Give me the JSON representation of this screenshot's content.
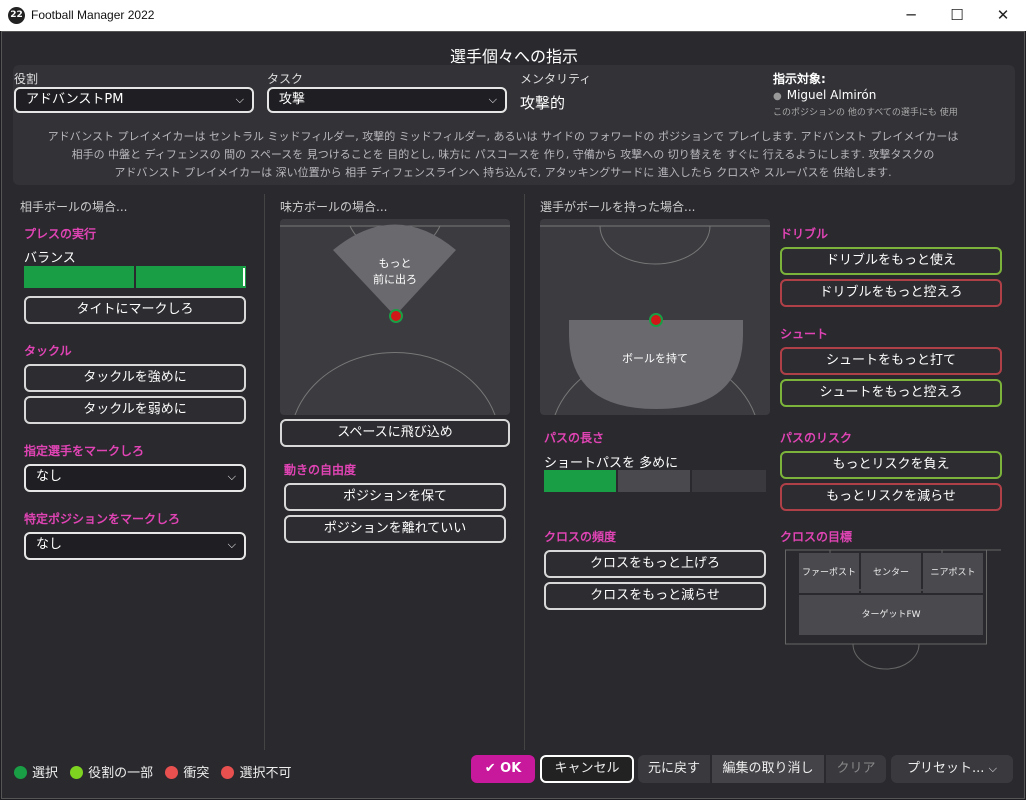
{
  "window": {
    "title": "Football Manager 2022",
    "logo": "22",
    "min": "─",
    "max": "☐",
    "close": "✕"
  },
  "dialog_title": "選手個々への指示",
  "role": {
    "label": "役割",
    "value": "アドバンストPM"
  },
  "task": {
    "label": "タスク",
    "value": "攻撃"
  },
  "mentality": {
    "label": "メンタリティ",
    "value": "攻撃的"
  },
  "target": {
    "label": "指示対象:",
    "player": "Miguel Almirón",
    "note": "このポジションの 他のすべての選手にも 使用"
  },
  "description": [
    "アドバンスト プレイメイカーは セントラル ミッドフィルダー, 攻撃的 ミッドフィルダー, あるいは サイドの フォワードの ポジションで プレイします. アドバンスト プレイメイカーは",
    "相手の 中盤と ディフェンスの 間の スペースを 見つけることを 目的とし, 味方に パスコースを 作り, 守備から 攻撃への 切り替えを すぐに 行えるようにします. 攻撃タスクの",
    "アドバンスト プレイメイカーは 深い位置から 相手 ディフェンスラインへ 持ち込んで, アタッキングサードに 進入したら クロスや スルーパスを 供給します."
  ],
  "opp_ball": {
    "header": "相手ボールの場合...",
    "press": {
      "label": "プレスの実行",
      "level_label": "バランス",
      "level": 0.5
    },
    "tight_mark": "タイトにマークしろ",
    "tackle": {
      "label": "タックル",
      "harder": "タックルを強めに",
      "softer": "タックルを弱めに"
    },
    "mark_player": {
      "label": "指定選手をマークしろ",
      "value": "なし"
    },
    "mark_position": {
      "label": "特定ポジションをマークしろ",
      "value": "なし"
    }
  },
  "team_ball": {
    "header": "味方ボールの場合...",
    "zone_label_1": "もっと",
    "zone_label_2": "前に出ろ",
    "run_space": "スペースに飛び込め",
    "freedom": {
      "label": "動きの自由度",
      "hold": "ポジションを保て",
      "roam": "ポジションを離れていい"
    }
  },
  "on_ball": {
    "header": "選手がボールを持った場合...",
    "zone_label": "ボールを持て",
    "pass_length": {
      "label": "パスの長さ",
      "value": "ショートパスを 多めに",
      "level": 1
    },
    "cross_freq": {
      "label": "クロスの頻度",
      "more": "クロスをもっと上げろ",
      "less": "クロスをもっと減らせ"
    },
    "dribble": {
      "label": "ドリブル",
      "more": "ドリブルをもっと使え",
      "less": "ドリブルをもっと控えろ"
    },
    "shoot": {
      "label": "シュート",
      "more": "シュートをもっと打て",
      "less": "シュートをもっと控えろ"
    },
    "pass_risk": {
      "label": "パスのリスク",
      "more": "もっとリスクを負え",
      "less": "もっとリスクを減らせ"
    },
    "cross_target": {
      "label": "クロスの目標",
      "far": "ファーポスト",
      "centre": "センター",
      "near": "ニアポスト",
      "fw": "ターゲットFW"
    }
  },
  "legend": {
    "selected": "選択",
    "role_part": "役割の一部",
    "conflict": "衝突",
    "unavailable": "選択不可"
  },
  "footer": {
    "ok": "OK",
    "cancel": "キャンセル",
    "revert": "元に戻す",
    "undo": "編集の取り消し",
    "clear": "クリア",
    "presets": "プリセット..."
  },
  "colors": {
    "accent": "#e044b4",
    "green": "#1a9e45",
    "lime": "#7ed321",
    "red": "#e85050"
  }
}
